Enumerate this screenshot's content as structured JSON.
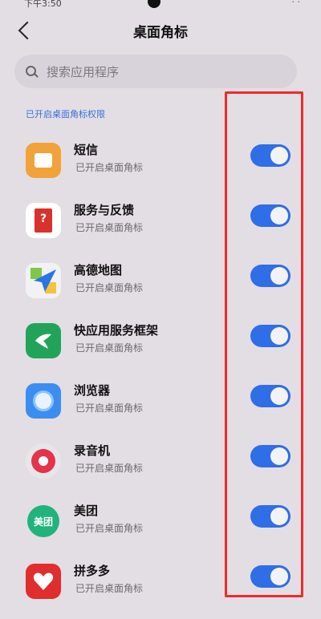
{
  "status": {
    "time": "下午3:50",
    "right": "· ·"
  },
  "header": {
    "title": "桌面角标"
  },
  "search": {
    "placeholder": "搜索应用程序"
  },
  "section_label": "已开启桌面角标权限",
  "apps": [
    {
      "name": "短信",
      "status": "已开启桌面角标",
      "icon": "sms-icon",
      "color": "#f2a23a",
      "enabled": true
    },
    {
      "name": "服务与反馈",
      "status": "已开启桌面角标",
      "icon": "feedback-icon",
      "color": "#ffffff",
      "enabled": true
    },
    {
      "name": "高德地图",
      "status": "已开启桌面角标",
      "icon": "amap-icon",
      "color": "#ffffff",
      "enabled": true
    },
    {
      "name": "快应用服务框架",
      "status": "已开启桌面角标",
      "icon": "quickapp-icon",
      "color": "#21a45a",
      "enabled": true
    },
    {
      "name": "浏览器",
      "status": "已开启桌面角标",
      "icon": "browser-icon",
      "color": "#3b8ef0",
      "enabled": true
    },
    {
      "name": "录音机",
      "status": "已开启桌面角标",
      "icon": "recorder-icon",
      "color": "#e6e6ea",
      "enabled": true
    },
    {
      "name": "美团",
      "status": "已开启桌面角标",
      "icon": "meituan-icon",
      "color": "#21b37c",
      "enabled": true
    },
    {
      "name": "拼多多",
      "status": "已开启桌面角标",
      "icon": "pinduoduo-icon",
      "color": "#e02d2d",
      "enabled": true
    }
  ],
  "icon_text": {
    "meituan": "美团"
  },
  "colors": {
    "toggle_on": "#2f6ee6",
    "highlight_box": "#ef2a2a",
    "section": "#3a6fd8"
  }
}
